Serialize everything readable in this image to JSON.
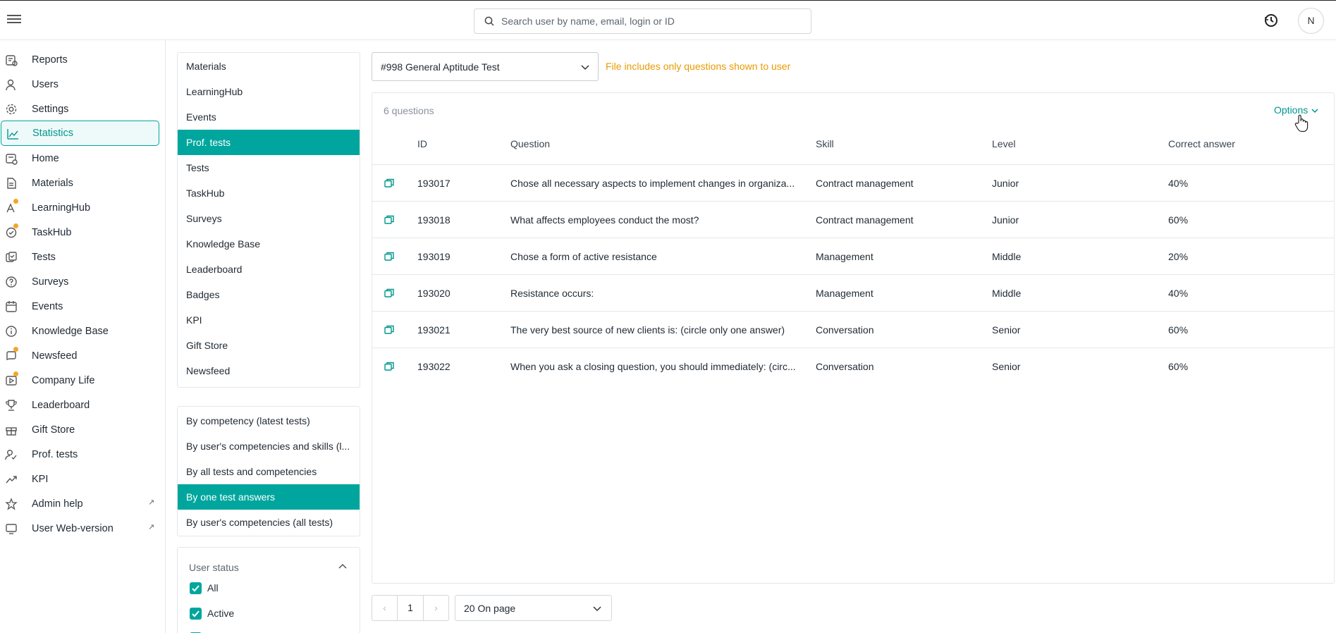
{
  "header": {
    "search_placeholder": "Search user by name, email, login or ID",
    "avatar_initial": "N"
  },
  "sidebar": {
    "items": [
      {
        "label": "Reports",
        "icon": "reports-icon"
      },
      {
        "label": "Users",
        "icon": "users-icon"
      },
      {
        "label": "Settings",
        "icon": "gear-icon"
      },
      {
        "label": "Statistics",
        "icon": "chart-line-icon",
        "active": true
      },
      {
        "label": "Home",
        "icon": "home-icon"
      },
      {
        "label": "Materials",
        "icon": "document-icon"
      },
      {
        "label": "LearningHub",
        "icon": "learninghub-icon",
        "badge": true
      },
      {
        "label": "TaskHub",
        "icon": "taskhub-icon",
        "badge": true
      },
      {
        "label": "Tests",
        "icon": "tests-icon"
      },
      {
        "label": "Surveys",
        "icon": "survey-icon"
      },
      {
        "label": "Events",
        "icon": "calendar-icon"
      },
      {
        "label": "Knowledge Base",
        "icon": "info-icon"
      },
      {
        "label": "Newsfeed",
        "icon": "newsfeed-icon",
        "badge": true
      },
      {
        "label": "Company Life",
        "icon": "company-life-icon",
        "badge": true
      },
      {
        "label": "Leaderboard",
        "icon": "trophy-icon"
      },
      {
        "label": "Gift Store",
        "icon": "gift-icon"
      },
      {
        "label": "Prof. tests",
        "icon": "prof-tests-icon"
      },
      {
        "label": "KPI",
        "icon": "trend-icon"
      },
      {
        "label": "Admin help",
        "icon": "star-icon",
        "external": true
      },
      {
        "label": "User Web-version",
        "icon": "monitor-icon",
        "external": true
      }
    ]
  },
  "modules": {
    "items": [
      "Materials",
      "LearningHub",
      "Events",
      "Prof. tests",
      "Tests",
      "TaskHub",
      "Surveys",
      "Knowledge Base",
      "Leaderboard",
      "Badges",
      "KPI",
      "Gift Store",
      "Newsfeed"
    ],
    "selected": "Prof. tests"
  },
  "report_types": {
    "items": [
      "By competency (latest tests)",
      "By user's competencies and skills (l...",
      "By all tests and competencies",
      "By one test answers",
      "By user's competencies (all tests)"
    ],
    "selected": "By one test answers"
  },
  "user_status": {
    "title": "User status",
    "options": [
      {
        "label": "All",
        "checked": true
      },
      {
        "label": "Active",
        "checked": true
      }
    ]
  },
  "main": {
    "test_select": "#998 General Aptitude Test",
    "notice": "File includes only questions shown to user",
    "question_count": "6 questions",
    "options_label": "Options",
    "columns": {
      "id": "ID",
      "question": "Question",
      "skill": "Skill",
      "level": "Level",
      "correct": "Correct answer"
    },
    "rows": [
      {
        "id": "193017",
        "question": "Chose all necessary aspects to implement changes in organiza...",
        "skill": "Contract management",
        "level": "Junior",
        "correct": "40%"
      },
      {
        "id": "193018",
        "question": "What affects employees conduct the most?",
        "skill": "Contract management",
        "level": "Junior",
        "correct": "60%"
      },
      {
        "id": "193019",
        "question": "Chose a form of active resistance",
        "skill": "Management",
        "level": "Middle",
        "correct": "20%"
      },
      {
        "id": "193020",
        "question": "Resistance occurs:",
        "skill": "Management",
        "level": "Middle",
        "correct": "40%"
      },
      {
        "id": "193021",
        "question": "The very best source of new clients is: (circle only one answer)",
        "skill": "Conversation",
        "level": "Senior",
        "correct": "60%"
      },
      {
        "id": "193022",
        "question": "When you ask a closing question, you should immediately: (circ...",
        "skill": "Conversation",
        "level": "Senior",
        "correct": "60%"
      }
    ]
  },
  "pagination": {
    "prev": "‹",
    "page": "1",
    "next": "›",
    "per_page": "20 On page"
  },
  "colors": {
    "accent": "#00a69d",
    "notice": "#e99a00",
    "badge": "#f5a524"
  }
}
